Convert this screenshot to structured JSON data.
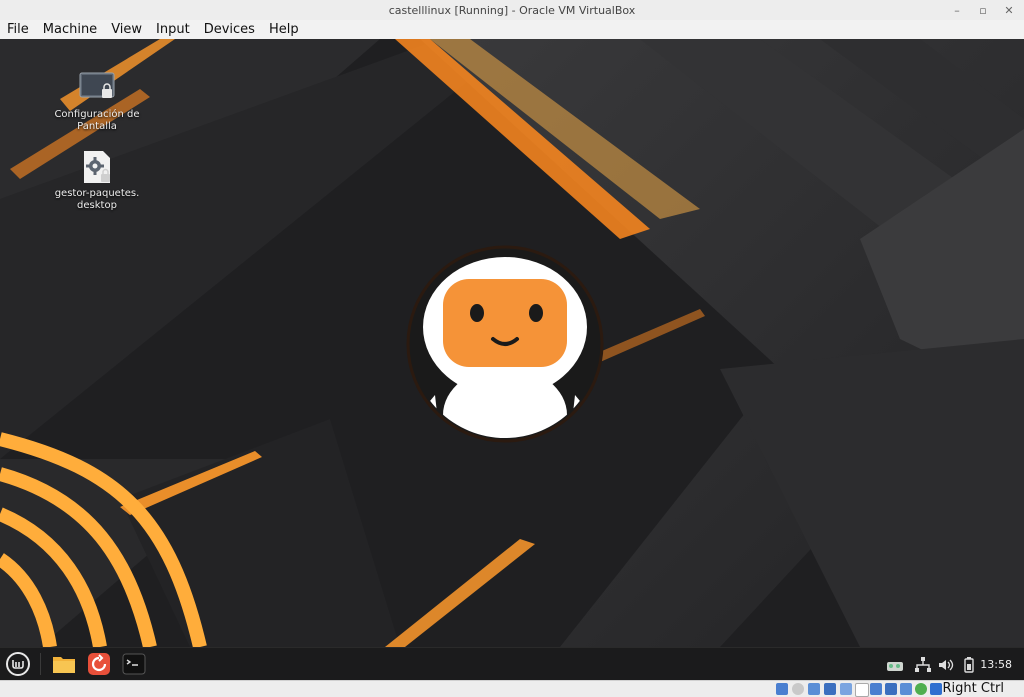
{
  "window": {
    "title": "castelllinux [Running] - Oracle VM VirtualBox"
  },
  "menu": [
    "File",
    "Machine",
    "View",
    "Input",
    "Devices",
    "Help"
  ],
  "desktop": {
    "icons": [
      {
        "label_line1": "Configuración de",
        "label_line2": "Pantalla",
        "icon": "monitor-icon"
      },
      {
        "label_line1": "gestor-paquetes.",
        "label_line2": "desktop",
        "icon": "gear-file-icon"
      }
    ],
    "mascot": "astronaut-mascot"
  },
  "taskbar": {
    "apps": [
      "mint-menu-icon",
      "files-folder-icon",
      "update-manager-icon",
      "terminal-icon"
    ],
    "tray": [
      "vm-tray-icon",
      "network-icon",
      "volume-icon",
      "battery-icon"
    ],
    "clock": "13:58"
  },
  "statusbar": {
    "host_key": "Right Ctrl"
  },
  "colors": {
    "accent_orange": "#ff9a2b",
    "mascot_face": "#f59338"
  }
}
